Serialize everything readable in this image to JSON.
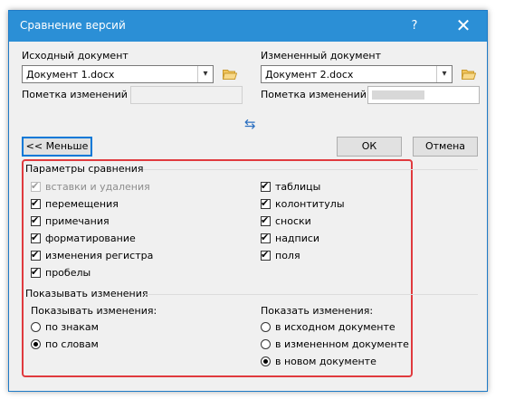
{
  "window": {
    "title": "Сравнение версий",
    "help": "?",
    "close": "✕"
  },
  "original": {
    "label": "Исходный документ",
    "value": "Документ 1.docx",
    "mark_label": "Пометка изменений"
  },
  "revised": {
    "label": "Измененный документ",
    "value": "Документ 2.docx",
    "mark_label": "Пометка изменений"
  },
  "swap_icon": "⇆",
  "buttons": {
    "less": "<< Меньше",
    "ok": "ОК",
    "cancel": "Отмена"
  },
  "comparison": {
    "title": "Параметры сравнения",
    "left": [
      {
        "label": "вставки и удаления",
        "checked": true,
        "disabled": true
      },
      {
        "label": "перемещения",
        "checked": true
      },
      {
        "label": "примечания",
        "checked": true
      },
      {
        "label": "форматирование",
        "checked": true
      },
      {
        "label": "изменения регистра",
        "checked": true
      },
      {
        "label": "пробелы",
        "checked": true
      }
    ],
    "right": [
      {
        "label": "таблицы",
        "checked": true
      },
      {
        "label": "колонтитулы",
        "checked": true
      },
      {
        "label": "сноски",
        "checked": true
      },
      {
        "label": "надписи",
        "checked": true
      },
      {
        "label": "поля",
        "checked": true
      }
    ]
  },
  "show": {
    "title": "Показывать изменения",
    "level": {
      "label": "Показывать изменения:",
      "options": [
        {
          "label": "по знакам",
          "selected": false
        },
        {
          "label": "по словам",
          "selected": true
        }
      ]
    },
    "location": {
      "label": "Показать изменения:",
      "options": [
        {
          "label": "в исходном документе",
          "selected": false
        },
        {
          "label": "в измененном документе",
          "selected": false
        },
        {
          "label": "в новом документе",
          "selected": true
        }
      ]
    }
  }
}
